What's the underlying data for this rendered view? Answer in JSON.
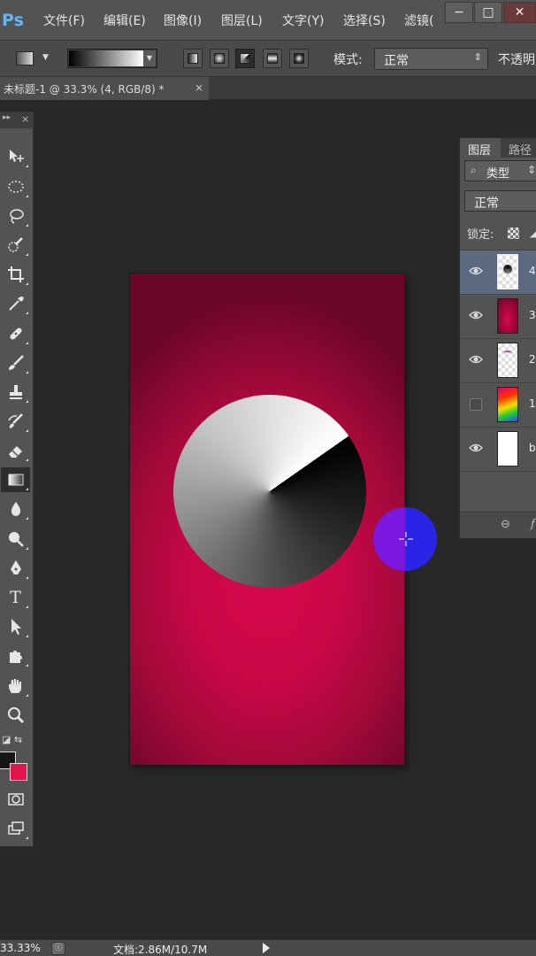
{
  "app": {
    "logo": "Ps"
  },
  "menu": [
    "文件(F)",
    "编辑(E)",
    "图像(I)",
    "图层(L)",
    "文字(Y)",
    "选择(S)",
    "滤镜("
  ],
  "window_controls": {
    "minimize": "−",
    "maximize": "□",
    "close": "✕"
  },
  "options": {
    "gradient_preview": "black-to-white",
    "gradient_types": [
      "linear",
      "radial",
      "angle",
      "reflected",
      "diamond"
    ],
    "active_gradient_type": "angle",
    "mode_label": "模式:",
    "mode_value": "正常",
    "opacity_label": "不透明"
  },
  "document_tab": {
    "title": "未标题-1 @ 33.3% (4, RGB/8) *",
    "close": "×"
  },
  "tools": [
    "move-tool",
    "marquee-tool",
    "lasso-tool",
    "quick-select-tool",
    "crop-tool",
    "eyedropper-tool",
    "healing-brush-tool",
    "brush-tool",
    "clone-stamp-tool",
    "history-brush-tool",
    "eraser-tool",
    "gradient-tool",
    "blur-tool",
    "dodge-tool",
    "pen-tool",
    "type-tool",
    "path-select-tool",
    "custom-shape-tool",
    "hand-tool",
    "zoom-tool"
  ],
  "active_tool": "gradient-tool",
  "type_tool_glyph": "T",
  "colors": {
    "foreground": "#161616",
    "background": "#e3134c",
    "canvas_center": "#d8074b",
    "canvas_edge": "#6b0628"
  },
  "layers_panel": {
    "tabs": [
      "图层",
      "路径"
    ],
    "kind_filter": "类型",
    "blend_mode": "正常",
    "lock_label": "锁定:",
    "layers": [
      {
        "name": "4",
        "visible": true,
        "selected": true,
        "thumb": "transparent-with-shape"
      },
      {
        "name": "3",
        "visible": true,
        "selected": false,
        "thumb": "crimson-gradient"
      },
      {
        "name": "2",
        "visible": true,
        "selected": false,
        "thumb": "transparent-with-pink"
      },
      {
        "name": "1",
        "visible": false,
        "selected": false,
        "thumb": "rainbow"
      },
      {
        "name": "b",
        "visible": true,
        "selected": false,
        "thumb": "white"
      }
    ]
  },
  "status": {
    "zoom": "33.33%",
    "doc_size": "文档:2.86M/10.7M"
  }
}
